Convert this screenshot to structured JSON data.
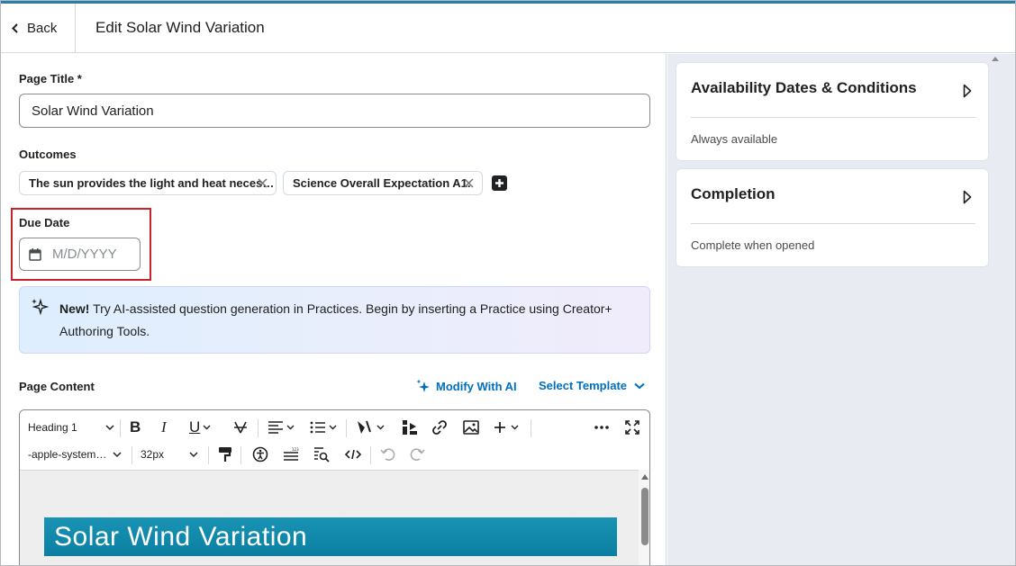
{
  "header": {
    "back_label": "Back",
    "title": "Edit Solar Wind Variation"
  },
  "form": {
    "page_title_label": "Page Title *",
    "page_title_value": "Solar Wind Variation",
    "outcomes_label": "Outcomes",
    "outcomes": [
      "The sun provides the light and heat neces…",
      "Science Overall Expectation A1."
    ],
    "due_date_label": "Due Date",
    "due_date_placeholder": "M/D/YYYY",
    "alert": {
      "new_label": "New!",
      "text": " Try AI-assisted question generation in Practices. Begin by inserting a Practice using Creator+ Authoring Tools."
    },
    "page_content_label": "Page Content",
    "modify_ai_label": "Modify With AI",
    "select_template_label": "Select Template"
  },
  "editor": {
    "block_format": "Heading 1",
    "font_family": "-apple-system…",
    "font_size": "32px",
    "content_heading": "Solar Wind Variation"
  },
  "sidebar": {
    "availability_title": "Availability Dates & Conditions",
    "availability_sub": "Always available",
    "completion_title": "Completion",
    "completion_sub": "Complete when opened"
  },
  "colors": {
    "link": "#006fbf",
    "highlight_border": "#c8232c",
    "banner": "#0a7fa1",
    "sidebar_bg": "#e8ecf2"
  }
}
